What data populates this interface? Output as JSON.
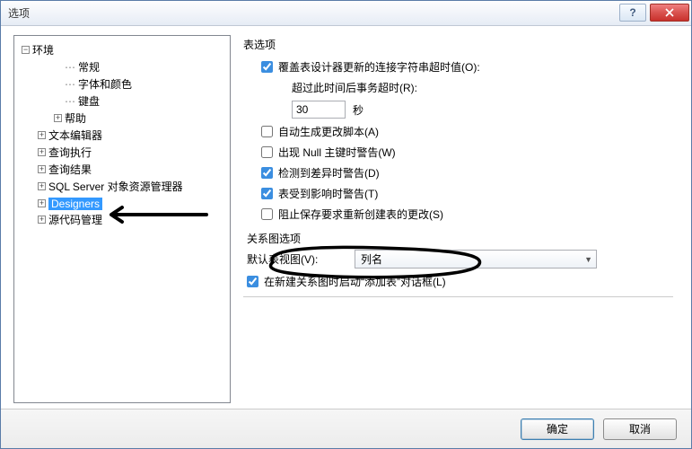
{
  "title": "选项",
  "tree": {
    "env": "环境",
    "general": "常规",
    "fonts": "字体和颜色",
    "keyboard": "键盘",
    "help": "帮助",
    "textEditor": "文本编辑器",
    "queryExec": "查询执行",
    "queryResults": "查询结果",
    "sqlExplorer": "SQL Server 对象资源管理器",
    "designers": "Designers",
    "sourceControl": "源代码管理"
  },
  "right": {
    "groupTitle": "表选项",
    "overrideConn": "覆盖表设计器更新的连接字符串超时值(O):",
    "timeoutLabel": "超过此时间后事务超时(R):",
    "timeoutValue": "30",
    "secondsLabel": "秒",
    "autoScript": "自动生成更改脚本(A)",
    "nullWarn": "出现 Null 主键时警告(W)",
    "diffWarn": "检测到差异时警告(D)",
    "affectWarn": "表受到影响时警告(T)",
    "preventSave": "阻止保存要求重新创建表的更改(S)",
    "diagramGroup": "关系图选项",
    "defaultViewLabel": "默认表视图(V):",
    "defaultViewValue": "列名",
    "launchAddTable": "在新建关系图时启动“添加表”对话框(L)"
  },
  "buttons": {
    "ok": "确定",
    "cancel": "取消"
  }
}
